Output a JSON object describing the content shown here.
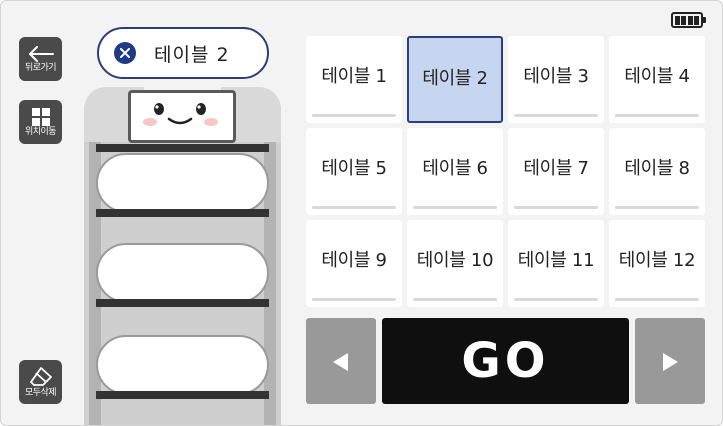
{
  "sidebar": {
    "back_label": "뒤로가기",
    "move_label": "위치이동",
    "clear_label": "모두삭제"
  },
  "selected_table": {
    "label": "테이블 2"
  },
  "tables": [
    {
      "label": "테이블 1",
      "selected": false
    },
    {
      "label": "테이블 2",
      "selected": true
    },
    {
      "label": "테이블 3",
      "selected": false
    },
    {
      "label": "테이블 4",
      "selected": false
    },
    {
      "label": "테이블 5",
      "selected": false
    },
    {
      "label": "테이블 6",
      "selected": false
    },
    {
      "label": "테이블 7",
      "selected": false
    },
    {
      "label": "테이블 8",
      "selected": false
    },
    {
      "label": "테이블 9",
      "selected": false
    },
    {
      "label": "테이블 10",
      "selected": false
    },
    {
      "label": "테이블 11",
      "selected": false
    },
    {
      "label": "테이블 12",
      "selected": false
    }
  ],
  "controls": {
    "go_label": "GO"
  },
  "battery": {
    "level": 1.0
  },
  "colors": {
    "accent": "#1f3b83",
    "selected_bg": "#c7d6f0",
    "go_bg": "#0f0f0f",
    "nav_bg": "#999999"
  }
}
